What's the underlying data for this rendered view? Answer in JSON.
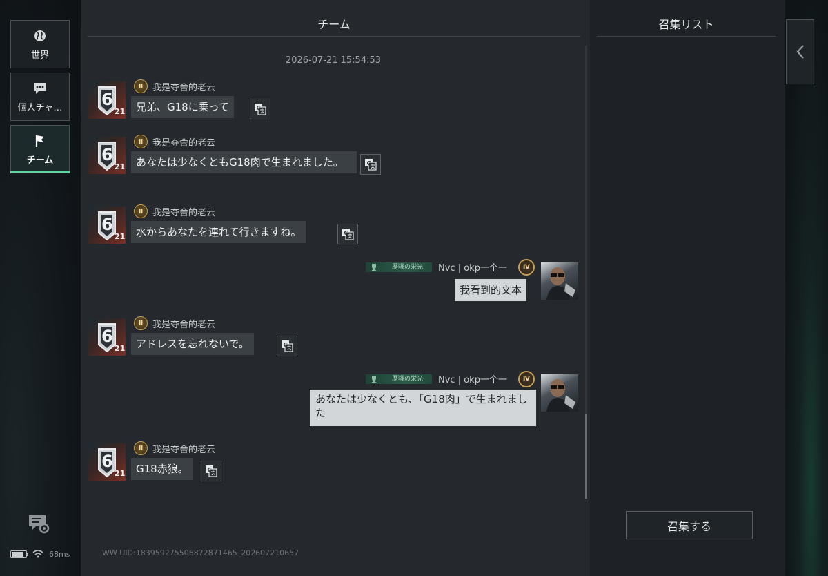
{
  "nav": {
    "tabs": [
      {
        "label": "世界",
        "icon": "globe-icon"
      },
      {
        "label": "個人チャ…",
        "icon": "chat-bubble-icon"
      },
      {
        "label": "チーム",
        "icon": "flag-icon",
        "active": true
      }
    ]
  },
  "status": {
    "ping": "68ms"
  },
  "chat": {
    "title": "チーム",
    "timestamp": "2026-07-21 15:54:53",
    "uid": "WW UID:1839592755068728714​65_202607210657",
    "messages": [
      {
        "sender": "我是夺舍的老云",
        "rank": "Ⅱ",
        "avatar_level": "6",
        "avatar_sub": "21",
        "text": "兄弟、G18に乗って"
      },
      {
        "sender": "我是夺舍的老云",
        "rank": "Ⅱ",
        "avatar_level": "6",
        "avatar_sub": "21",
        "text": "あなたは少なくともG18肉で生まれました。"
      },
      {
        "sender": "我是夺舍的老云",
        "rank": "Ⅱ",
        "avatar_level": "6",
        "avatar_sub": "21",
        "text": "水からあなたを連れて行きますね。"
      },
      {
        "sender": "Nvc | okp一个一",
        "rank": "Ⅳ",
        "tag": "歴戦の栄光",
        "text": "我看到的文本",
        "mine": true
      },
      {
        "sender": "我是夺舍的老云",
        "rank": "Ⅱ",
        "avatar_level": "6",
        "avatar_sub": "21",
        "text": "アドレスを忘れないで。"
      },
      {
        "sender": "Nvc | okp一个一",
        "rank": "Ⅳ",
        "tag": "歴戦の栄光",
        "text": "あなたは少なくとも、「G18肉」で生まれました",
        "mine": true
      },
      {
        "sender": "我是夺舍的老云",
        "rank": "Ⅱ",
        "avatar_level": "6",
        "avatar_sub": "21",
        "text": "G18赤狼。"
      }
    ]
  },
  "summon": {
    "title": "召集リスト",
    "button_label": "召集する"
  },
  "colors": {
    "accent": "#5fd3a4",
    "bubble_other": "#3b4045",
    "bubble_mine": "#d3d6d8"
  }
}
